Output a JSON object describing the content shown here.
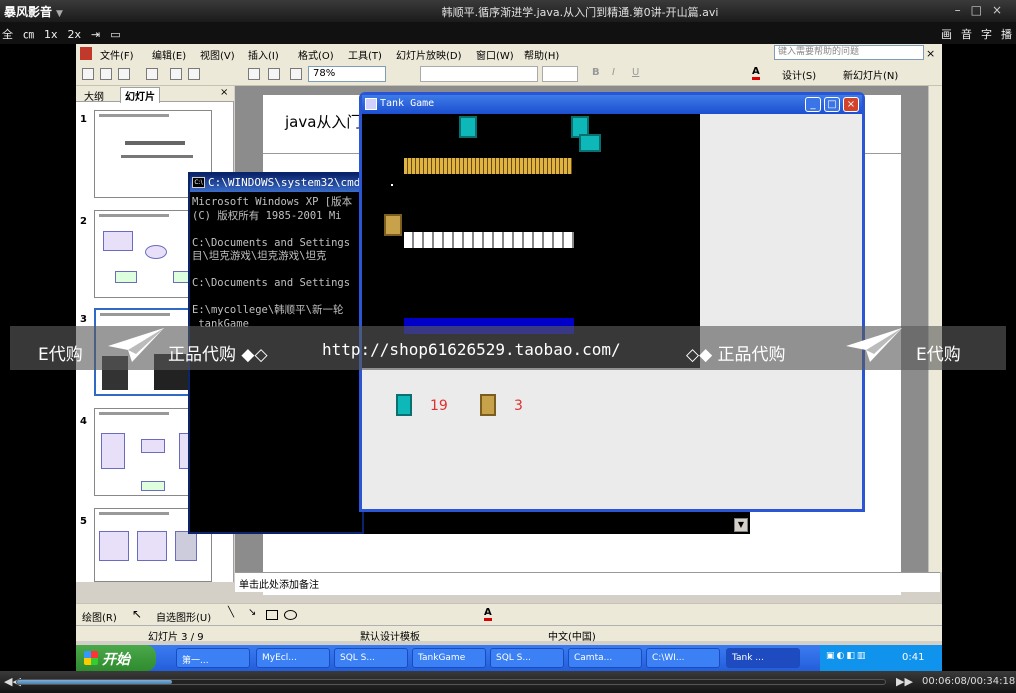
{
  "player": {
    "app_name": "暴风影音",
    "file_title": "韩顺平.循序渐进学.java.从入门到精通.第0讲-开山篇.avi",
    "toolbar_left": [
      "全",
      "㎝",
      "1x",
      "2x",
      "⇥",
      "▭"
    ],
    "toolbar_right": [
      "画",
      "音",
      "字",
      "播"
    ],
    "time_display": "00:06:08/00:34:18",
    "progress": 0.179
  },
  "ppt": {
    "menu": [
      "文件(F)",
      "编辑(E)",
      "视图(V)",
      "插入(I)",
      "格式(O)",
      "工具(T)",
      "幻灯片放映(D)",
      "窗口(W)",
      "帮助(H)"
    ],
    "help_placeholder": "键入需要帮助的问题",
    "zoom": "78%",
    "design_label": "设计(S)",
    "new_slide_label": "新幻灯片(N)",
    "tab_outline": "大纲",
    "tab_slides": "幻灯片",
    "slide_numbers": [
      "1",
      "2",
      "3",
      "4",
      "5"
    ],
    "slide_title": "java从入门",
    "notes_placeholder": "单击此处添加备注",
    "draw_label": "绘图(R)",
    "autoshape_label": "自选图形(U)",
    "status_slide": "幻灯片 3 / 9",
    "status_design": "默认设计模板",
    "status_lang": "中文(中国)"
  },
  "cmd": {
    "title": "C:\\WINDOWS\\system32\\cmd.exe",
    "lines": [
      "Microsoft Windows XP [版本",
      "(C) 版权所有 1985-2001 Mi",
      "",
      "C:\\Documents and Settings",
      "目\\坦克游戏\\坦克游戏\\坦克",
      "",
      "C:\\Documents and Settings",
      "",
      "E:\\mycollege\\韩顺平\\新一轮",
      " tankGame"
    ]
  },
  "tank_game": {
    "title": "Tank Game",
    "player_score": "19",
    "enemy_score": "3"
  },
  "watermark": {
    "left": "E代购",
    "mid_left": "正品代购 ◆◇",
    "url": "http://shop61626529.taobao.com/",
    "mid_right": "◇◆ 正品代购",
    "right": "E代购"
  },
  "taskbar": {
    "start": "开始",
    "tasks": [
      "第一...",
      "MyEcl...",
      "SQL S...",
      "TankGame",
      "SQL S...",
      "Camta...",
      "C:\\WI...",
      "Tank ..."
    ],
    "clock": "0:41"
  },
  "colors": {
    "xp_blue": "#245edb",
    "enemy_tank": "#0fb8b8",
    "player_tank": "#c8a24a",
    "score_text": "#e03030"
  }
}
